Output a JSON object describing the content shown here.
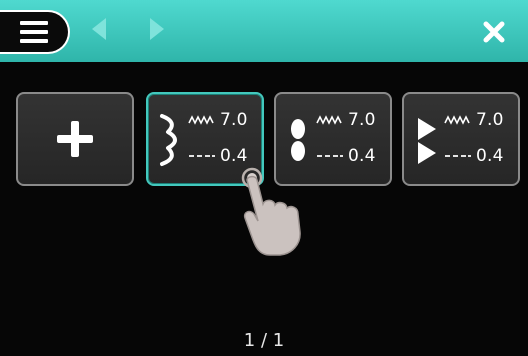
{
  "toolbar": {
    "menu_icon": "hamburger-menu-icon",
    "back_icon": "arrow-left-icon",
    "forward_icon": "arrow-right-icon",
    "close_icon": "close-x-icon",
    "accent": "#3cc3b8"
  },
  "tiles": [
    {
      "type": "add",
      "icon": "plus-icon"
    },
    {
      "icon": "zigzag-satin-stitch-icon",
      "width_icon": "stitch-width-icon",
      "width": "7.0",
      "length_icon": "stitch-length-icon",
      "length": "0.4",
      "selected": true
    },
    {
      "icon": "oval-satin-stitch-icon",
      "width_icon": "stitch-width-icon",
      "width": "7.0",
      "length_icon": "stitch-length-icon",
      "length": "0.4",
      "selected": false
    },
    {
      "icon": "triangle-satin-stitch-icon",
      "width_icon": "stitch-width-icon",
      "width": "7.0",
      "length_icon": "stitch-length-icon",
      "length": "0.4",
      "selected": false
    }
  ],
  "pointer": {
    "icon": "touch-hand-icon"
  },
  "pagination": {
    "text": "1 / 1"
  }
}
